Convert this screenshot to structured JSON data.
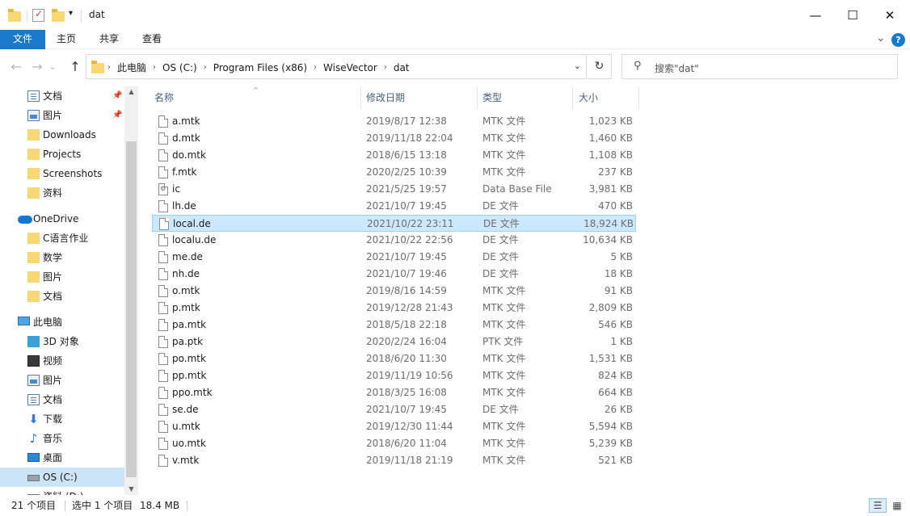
{
  "window": {
    "title": "dat",
    "minimize_glyph": "—",
    "maximize_glyph": "☐",
    "close_glyph": "✕",
    "customize_glyph": "▾"
  },
  "ribbon": {
    "tabs": [
      "文件",
      "主页",
      "共享",
      "查看"
    ],
    "collapse_glyph": "⌄",
    "help_glyph": "?"
  },
  "nav": {
    "back_glyph": "←",
    "forward_glyph": "→",
    "recent_glyph": "⌄",
    "up_glyph": "↑"
  },
  "address": {
    "crumbs": [
      "此电脑",
      "OS (C:)",
      "Program Files (x86)",
      "WiseVector",
      "dat"
    ],
    "separator": "›",
    "dropdown_glyph": "⌄",
    "refresh_glyph": "↻"
  },
  "search": {
    "placeholder": "搜索\"dat\"",
    "icon": "search-icon"
  },
  "sidebar": {
    "items": [
      {
        "label": "文档",
        "icon": "documents-icon",
        "pinned": true
      },
      {
        "label": "图片",
        "icon": "pictures-icon",
        "pinned": true
      },
      {
        "label": "Downloads",
        "icon": "folder-icon"
      },
      {
        "label": "Projects",
        "icon": "folder-icon"
      },
      {
        "label": "Screenshots",
        "icon": "folder-icon"
      },
      {
        "label": "资料",
        "icon": "folder-icon"
      },
      {
        "label": "OneDrive",
        "icon": "onedrive-icon"
      },
      {
        "label": "C语言作业",
        "icon": "folder-icon"
      },
      {
        "label": "数学",
        "icon": "folder-icon"
      },
      {
        "label": "图片",
        "icon": "folder-icon"
      },
      {
        "label": "文档",
        "icon": "folder-icon"
      },
      {
        "label": "此电脑",
        "icon": "this-pc-icon"
      },
      {
        "label": "3D 对象",
        "icon": "3d-objects-icon"
      },
      {
        "label": "视频",
        "icon": "videos-icon"
      },
      {
        "label": "图片",
        "icon": "pictures-icon"
      },
      {
        "label": "文档",
        "icon": "documents-icon"
      },
      {
        "label": "下载",
        "icon": "downloads-icon"
      },
      {
        "label": "音乐",
        "icon": "music-icon"
      },
      {
        "label": "桌面",
        "icon": "desktop-icon"
      },
      {
        "label": "OS (C:)",
        "icon": "drive-icon",
        "selected": true
      },
      {
        "label": "资料 (D:)",
        "icon": "drive-icon"
      }
    ],
    "pin_glyph": "📌"
  },
  "columns": {
    "name": "名称",
    "date": "修改日期",
    "type": "类型",
    "size": "大小",
    "sort_glyph": "^"
  },
  "files": [
    {
      "name": "a.mtk",
      "date": "2019/8/17 12:38",
      "type": "MTK 文件",
      "size": "1,023 KB"
    },
    {
      "name": "d.mtk",
      "date": "2019/11/18 22:04",
      "type": "MTK 文件",
      "size": "1,460 KB"
    },
    {
      "name": "do.mtk",
      "date": "2018/6/15 13:18",
      "type": "MTK 文件",
      "size": "1,108 KB"
    },
    {
      "name": "f.mtk",
      "date": "2020/2/25 10:39",
      "type": "MTK 文件",
      "size": "237 KB"
    },
    {
      "name": "ic",
      "date": "2021/5/25 19:57",
      "type": "Data Base File",
      "size": "3,981 KB",
      "db": true
    },
    {
      "name": "lh.de",
      "date": "2021/10/7 19:45",
      "type": "DE 文件",
      "size": "470 KB"
    },
    {
      "name": "local.de",
      "date": "2021/10/22 23:11",
      "type": "DE 文件",
      "size": "18,924 KB",
      "selected": true
    },
    {
      "name": "localu.de",
      "date": "2021/10/22 22:56",
      "type": "DE 文件",
      "size": "10,634 KB"
    },
    {
      "name": "me.de",
      "date": "2021/10/7 19:45",
      "type": "DE 文件",
      "size": "5 KB"
    },
    {
      "name": "nh.de",
      "date": "2021/10/7 19:46",
      "type": "DE 文件",
      "size": "18 KB"
    },
    {
      "name": "o.mtk",
      "date": "2019/8/16 14:59",
      "type": "MTK 文件",
      "size": "91 KB"
    },
    {
      "name": "p.mtk",
      "date": "2019/12/28 21:43",
      "type": "MTK 文件",
      "size": "2,809 KB"
    },
    {
      "name": "pa.mtk",
      "date": "2018/5/18 22:18",
      "type": "MTK 文件",
      "size": "546 KB"
    },
    {
      "name": "pa.ptk",
      "date": "2020/2/24 16:04",
      "type": "PTK 文件",
      "size": "1 KB"
    },
    {
      "name": "po.mtk",
      "date": "2018/6/20 11:30",
      "type": "MTK 文件",
      "size": "1,531 KB"
    },
    {
      "name": "pp.mtk",
      "date": "2019/11/19 10:56",
      "type": "MTK 文件",
      "size": "824 KB"
    },
    {
      "name": "ppo.mtk",
      "date": "2018/3/25 16:08",
      "type": "MTK 文件",
      "size": "664 KB"
    },
    {
      "name": "se.de",
      "date": "2021/10/7 19:45",
      "type": "DE 文件",
      "size": "26 KB"
    },
    {
      "name": "u.mtk",
      "date": "2019/12/30 11:44",
      "type": "MTK 文件",
      "size": "5,594 KB"
    },
    {
      "name": "uo.mtk",
      "date": "2018/6/20 11:04",
      "type": "MTK 文件",
      "size": "5,239 KB"
    },
    {
      "name": "v.mtk",
      "date": "2019/11/18 21:19",
      "type": "MTK 文件",
      "size": "521 KB"
    }
  ],
  "status": {
    "item_count": "21 个项目",
    "selection": "选中 1 个项目",
    "selection_size": "18.4 MB",
    "details_view_glyph": "☰",
    "tiles_view_glyph": "▦"
  },
  "colors": {
    "accent": "#1979ca",
    "selection": "#cce8ff",
    "selection_border": "#99d1ff",
    "nav_selection": "#cce4f7"
  }
}
